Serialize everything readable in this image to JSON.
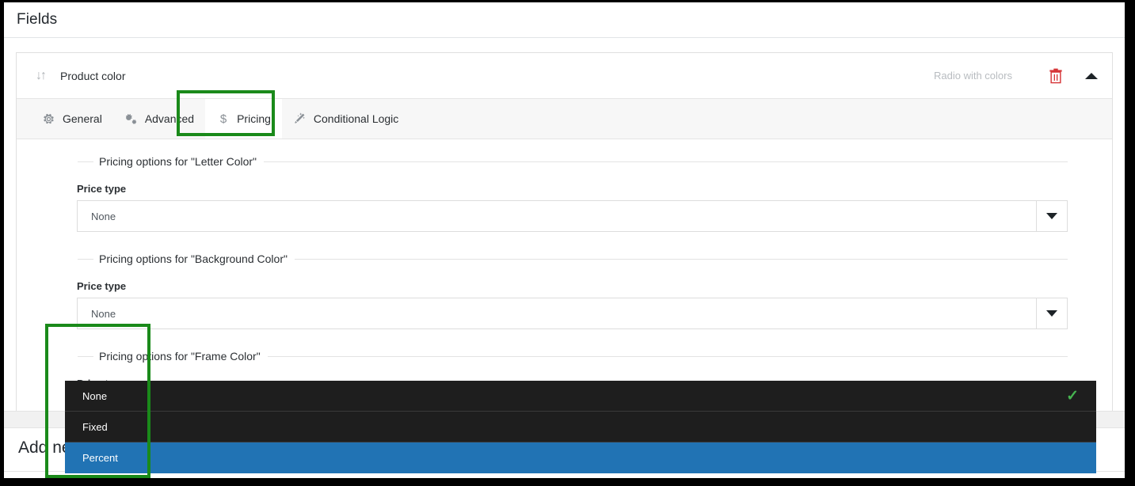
{
  "page": {
    "heading": "Fields"
  },
  "field": {
    "sort_icon": "sort-updown-icon",
    "title": "Product color",
    "type_label": "Radio with colors",
    "delete_icon": "trash-icon",
    "collapse_icon": "caret-up-icon"
  },
  "tabs": [
    {
      "label": "General",
      "icon": "gear-icon",
      "glyph": "⚙",
      "active": false
    },
    {
      "label": "Advanced",
      "icon": "sliders-gears-icon",
      "glyph": "⚙",
      "active": false
    },
    {
      "label": "Pricing",
      "icon": "dollar-icon",
      "glyph": "$",
      "active": true
    },
    {
      "label": "Conditional Logic",
      "icon": "magic-wand-icon",
      "glyph": "✦",
      "active": false
    }
  ],
  "pricing_groups": [
    {
      "legend": "Pricing options for \"Letter Color\"",
      "label": "Price type",
      "value": "None",
      "open": false,
      "arrow": "caret-down-icon"
    },
    {
      "legend": "Pricing options for \"Background Color\"",
      "label": "Price type",
      "value": "None",
      "open": false,
      "arrow": "caret-down-icon"
    },
    {
      "legend": "Pricing options for \"Frame Color\"",
      "label": "Price type",
      "value": "None",
      "open": true,
      "arrow": "caret-up-icon"
    }
  ],
  "dropdown": {
    "options": [
      {
        "label": "None",
        "selected": true,
        "highlighted": false,
        "check": "✓"
      },
      {
        "label": "Fixed",
        "selected": false,
        "highlighted": false,
        "check": ""
      },
      {
        "label": "Percent",
        "selected": false,
        "highlighted": true,
        "check": ""
      }
    ]
  },
  "footer": {
    "add_new": "Add new field"
  },
  "annotations": [
    {
      "name": "pricing-tab-highlight",
      "color": "#1a8a1a"
    },
    {
      "name": "price-type-dropdown-highlight",
      "color": "#1a8a1a"
    }
  ],
  "colors": {
    "accent_blue": "#2271b1",
    "highlight_blue": "#2173b4",
    "menu_dark": "#1e1e1e",
    "check_green": "#46b450",
    "annotation_green": "#1a8a1a",
    "trash_red": "#d63638"
  }
}
